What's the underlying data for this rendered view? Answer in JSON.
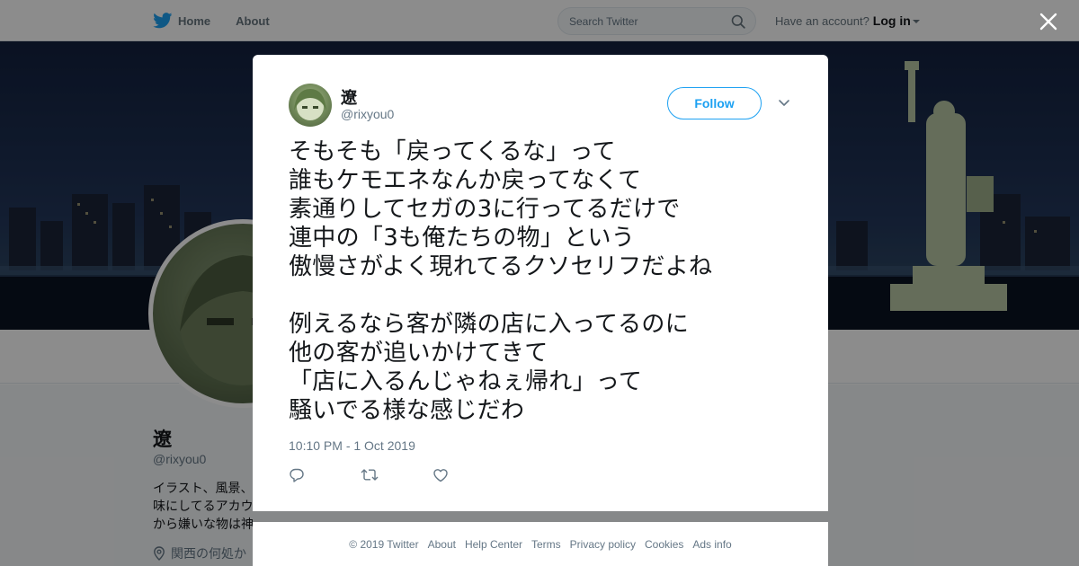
{
  "nav": {
    "home_label": "Home",
    "about_label": "About",
    "search_placeholder": "Search Twitter",
    "account_prompt": "Have an account?",
    "login_label": "Log in"
  },
  "profile": {
    "name": "遼",
    "handle": "@rixyou0",
    "bio_fragment": "イラスト、風景、\n味にしてるアカウ\nから嫌いな物は神",
    "location_fragment": "関西の何処か"
  },
  "tweet": {
    "author_name": "遼",
    "author_handle": "@rixyou0",
    "follow_label": "Follow",
    "text": "そもそも「戻ってくるな」って\n誰もケモエネなんか戻ってなくて\n素通りしてセガの3に行ってるだけで\n連中の「3も俺たちの物」という\n傲慢さがよく現れてるクソセリフだよね\n\n例えるなら客が隣の店に入ってるのに\n他の客が追いかけてきて\n「店に入るんじゃねぇ帰れ」って\n騒いでる様な感じだわ",
    "timestamp": "10:10 PM - 1 Oct 2019"
  },
  "footer": {
    "links": [
      "© 2019 Twitter",
      "About",
      "Help Center",
      "Terms",
      "Privacy policy",
      "Cookies",
      "Ads info"
    ]
  },
  "colors": {
    "brand": "#1da1f2",
    "text_secondary": "#657786"
  },
  "icons": [
    "twitter-bird-icon",
    "search-icon",
    "close-icon",
    "chevron-down-icon",
    "reply-icon",
    "retweet-icon",
    "like-icon",
    "location-icon"
  ]
}
